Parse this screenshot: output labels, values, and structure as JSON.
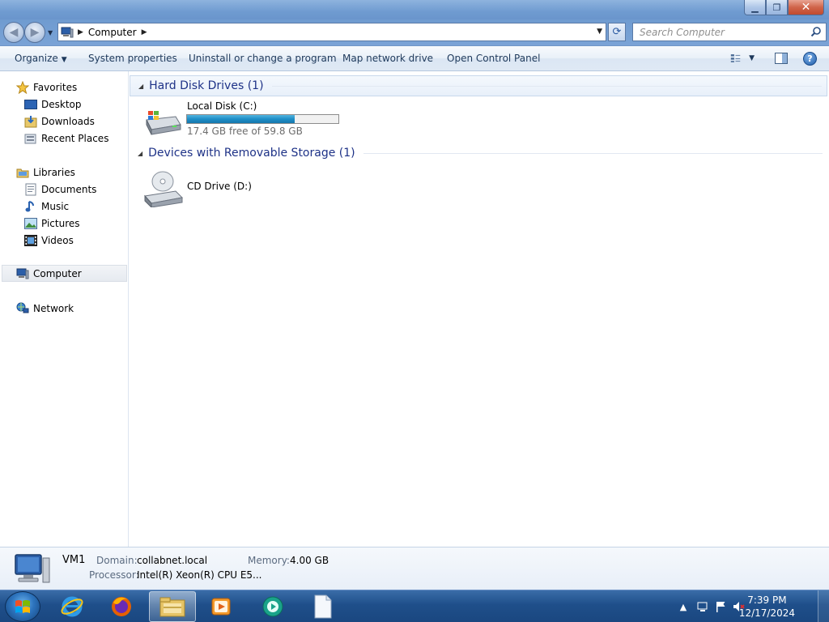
{
  "window": {
    "caption": {
      "minimize": "▁",
      "maximize": "❐",
      "close": "✕"
    }
  },
  "address": {
    "path": "Computer",
    "search_placeholder": "Search Computer"
  },
  "toolbar": {
    "organize": "Organize",
    "system_properties": "System properties",
    "uninstall": "Uninstall or change a program",
    "map_drive": "Map network drive",
    "control_panel": "Open Control Panel",
    "help": "?"
  },
  "sidebar": {
    "favorites": {
      "label": "Favorites",
      "icon": "star-icon"
    },
    "favorites_items": [
      {
        "label": "Desktop",
        "icon": "desktop-icon"
      },
      {
        "label": "Downloads",
        "icon": "downloads-icon"
      },
      {
        "label": "Recent Places",
        "icon": "recent-places-icon"
      }
    ],
    "libraries": {
      "label": "Libraries",
      "icon": "libraries-icon"
    },
    "libraries_items": [
      {
        "label": "Documents",
        "icon": "documents-icon"
      },
      {
        "label": "Music",
        "icon": "music-icon"
      },
      {
        "label": "Pictures",
        "icon": "pictures-icon"
      },
      {
        "label": "Videos",
        "icon": "videos-icon"
      }
    ],
    "computer": {
      "label": "Computer",
      "icon": "computer-icon"
    },
    "network": {
      "label": "Network",
      "icon": "network-icon"
    }
  },
  "content": {
    "groups": [
      {
        "header": "Hard Disk Drives (1)",
        "items": [
          {
            "name": "Local Disk (C:)",
            "free": "17.4 GB free of 59.8 GB",
            "used_fraction": 0.709
          }
        ]
      },
      {
        "header": "Devices with Removable Storage (1)",
        "items": [
          {
            "name": "CD Drive (D:)"
          }
        ]
      }
    ]
  },
  "details": {
    "name": "VM1",
    "domain_label": "Domain:",
    "domain_value": "collabnet.local",
    "memory_label": "Memory:",
    "memory_value": "4.00 GB",
    "processor_label": "Processor:",
    "processor_value": "Intel(R) Xeon(R) CPU E5..."
  },
  "taskbar": {
    "time": "7:39 PM",
    "date": "12/17/2024",
    "tray_up": "▲",
    "colors": {
      "bar": "#1f4f8a",
      "accent": "#2d74be"
    }
  }
}
